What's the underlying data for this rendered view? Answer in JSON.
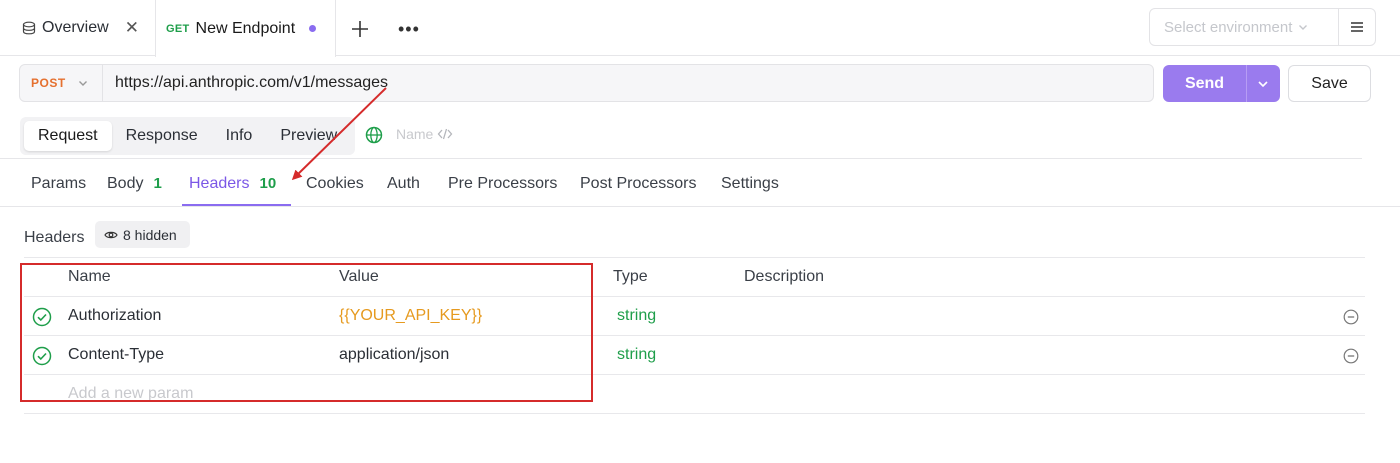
{
  "tabs": {
    "overview_label": "Overview",
    "active": {
      "method": "GET",
      "title": "New Endpoint"
    }
  },
  "environment": {
    "placeholder": "Select environment"
  },
  "request": {
    "method": "POST",
    "url": "https://api.anthropic.com/v1/messages",
    "send_label": "Send",
    "save_label": "Save"
  },
  "segments": {
    "request": "Request",
    "response": "Response",
    "info": "Info",
    "preview": "Preview",
    "name_placeholder": "Name"
  },
  "subtabs": {
    "params": "Params",
    "body": "Body",
    "body_count": "1",
    "headers": "Headers",
    "headers_count": "10",
    "cookies": "Cookies",
    "auth": "Auth",
    "pre": "Pre Processors",
    "post": "Post Processors",
    "settings": "Settings"
  },
  "headers_section": {
    "label": "Headers",
    "hidden": "8 hidden",
    "columns": {
      "name": "Name",
      "value": "Value",
      "type": "Type",
      "description": "Description"
    },
    "rows": [
      {
        "name": "Authorization",
        "value": "{{YOUR_API_KEY}}",
        "type": "string"
      },
      {
        "name": "Content-Type",
        "value": "application/json",
        "type": "string"
      }
    ],
    "add_placeholder": "Add a new param"
  },
  "colors": {
    "accent": "#8a6cf0",
    "send": "#9a7bee",
    "post_method": "#e5702f",
    "get_method": "#1e9e4a",
    "variable": "#e69a1f",
    "annotation": "#d52b2b"
  }
}
